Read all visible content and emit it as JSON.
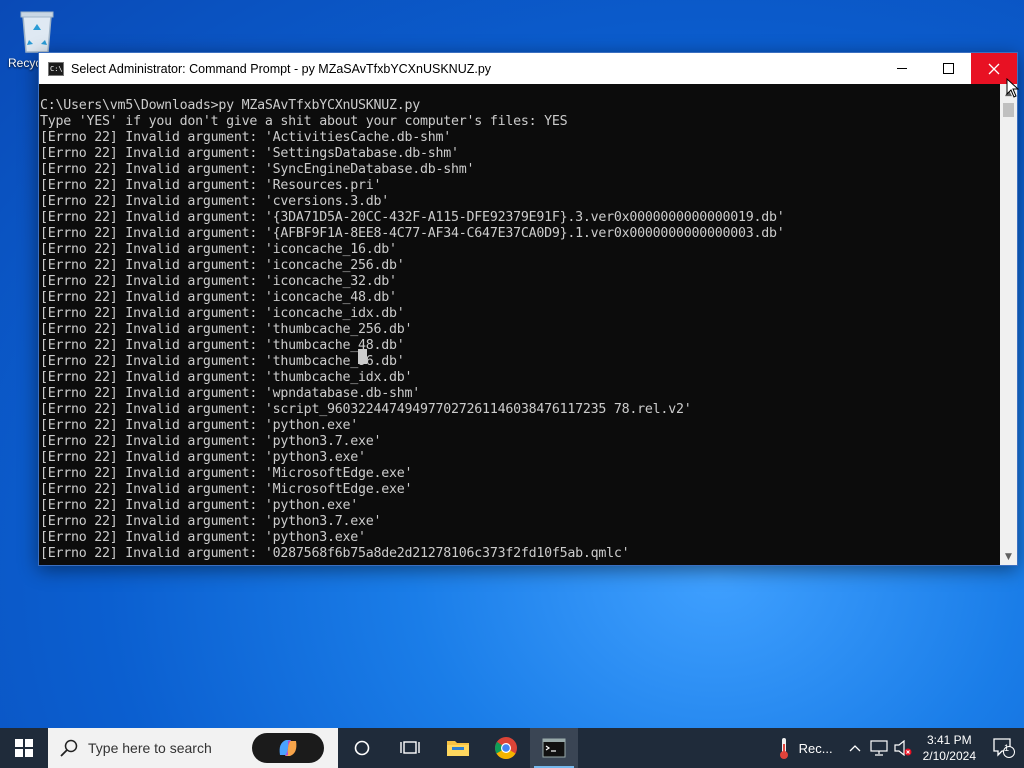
{
  "desktop": {
    "icon_label": "Recyc"
  },
  "window": {
    "title": "Select Administrator: Command Prompt - py  MZaSAvTfxbYCXnUSKNUZ.py",
    "icon_text": "C:\\",
    "accent_close": "#e81123"
  },
  "console": {
    "lines": [
      "",
      "C:\\Users\\vm5\\Downloads>py MZaSAvTfxbYCXnUSKNUZ.py",
      "Type 'YES' if you don't give a shit about your computer's files: YES",
      "[Errno 22] Invalid argument: 'ActivitiesCache.db-shm'",
      "[Errno 22] Invalid argument: 'SettingsDatabase.db-shm'",
      "[Errno 22] Invalid argument: 'SyncEngineDatabase.db-shm'",
      "[Errno 22] Invalid argument: 'Resources.pri'",
      "[Errno 22] Invalid argument: 'cversions.3.db'",
      "[Errno 22] Invalid argument: '{3DA71D5A-20CC-432F-A115-DFE92379E91F}.3.ver0x0000000000000019.db'",
      "[Errno 22] Invalid argument: '{AFBF9F1A-8EE8-4C77-AF34-C647E37CA0D9}.1.ver0x0000000000000003.db'",
      "[Errno 22] Invalid argument: 'iconcache_16.db'",
      "[Errno 22] Invalid argument: 'iconcache_256.db'",
      "[Errno 22] Invalid argument: 'iconcache_32.db'",
      "[Errno 22] Invalid argument: 'iconcache_48.db'",
      "[Errno 22] Invalid argument: 'iconcache_idx.db'",
      "[Errno 22] Invalid argument: 'thumbcache_256.db'",
      "[Errno 22] Invalid argument: 'thumbcache_48.db'",
      "[Errno 22] Invalid argument: 'thumbcache_96.db'",
      "[Errno 22] Invalid argument: 'thumbcache_idx.db'",
      "[Errno 22] Invalid argument: 'wpndatabase.db-shm'",
      "[Errno 22] Invalid argument: 'script_960322447494977027261146038476117235 78.rel.v2'",
      "[Errno 22] Invalid argument: 'python.exe'",
      "[Errno 22] Invalid argument: 'python3.7.exe'",
      "[Errno 22] Invalid argument: 'python3.exe'",
      "[Errno 22] Invalid argument: 'MicrosoftEdge.exe'",
      "[Errno 22] Invalid argument: 'MicrosoftEdge.exe'",
      "[Errno 22] Invalid argument: 'python.exe'",
      "[Errno 22] Invalid argument: 'python3.7.exe'",
      "[Errno 22] Invalid argument: 'python3.exe'",
      "[Errno 22] Invalid argument: '0287568f6b75a8de2d21278106c373f2fd10f5ab.qmlc'"
    ]
  },
  "taskbar": {
    "search_placeholder": "Type here to search",
    "tray_app_label": "Rec...",
    "time": "3:41 PM",
    "date": "2/10/2024",
    "notification_count": "1"
  }
}
